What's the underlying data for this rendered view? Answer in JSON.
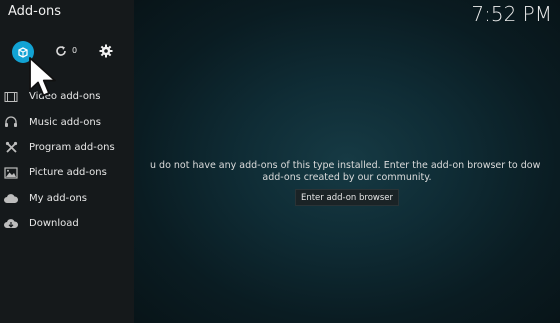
{
  "window": {
    "title": "Add-ons",
    "clock": "7:52 PM"
  },
  "toolbar": {
    "box_icon": "addon-box-icon",
    "refresh_icon": "refresh-icon",
    "update_count": "0",
    "settings_icon": "gear-icon",
    "accent": "#12a3d4"
  },
  "menu": {
    "items": [
      {
        "label": "Video add-ons",
        "icon": "video-icon"
      },
      {
        "label": "Music add-ons",
        "icon": "headphones-icon"
      },
      {
        "label": "Program add-ons",
        "icon": "tools-icon"
      },
      {
        "label": "Picture add-ons",
        "icon": "picture-icon"
      },
      {
        "label": "My add-ons",
        "icon": "cloud-icon"
      },
      {
        "label": "Download",
        "icon": "download-cloud-icon"
      }
    ]
  },
  "main": {
    "message_line1": "u do not have any add-ons of this type installed. Enter the add-on browser to dow",
    "message_line2": "add-ons created by our community.",
    "browse_button": "Enter add-on browser"
  }
}
